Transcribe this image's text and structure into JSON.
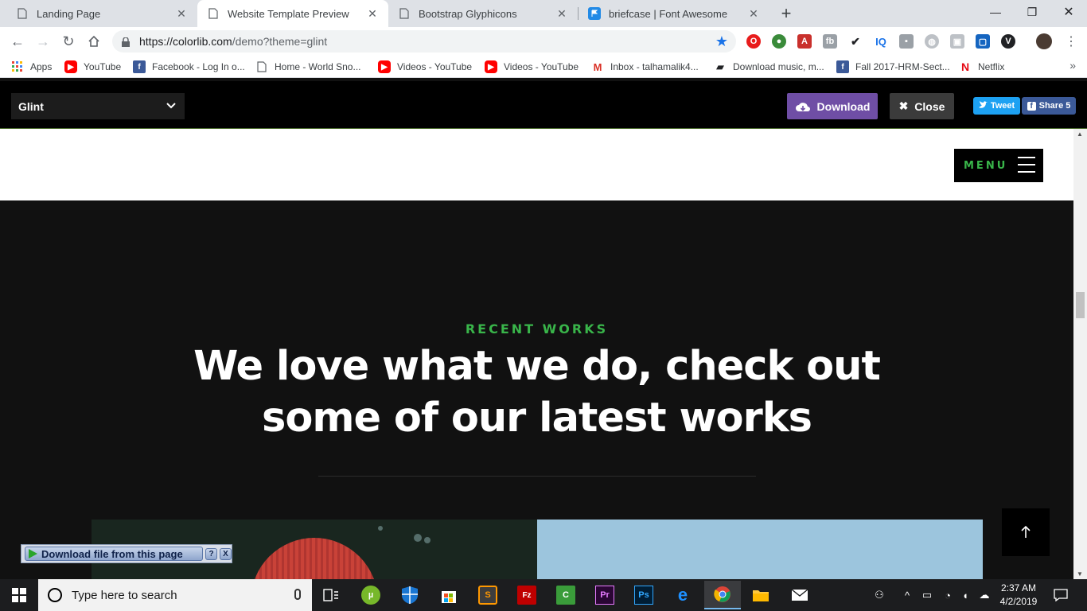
{
  "browser": {
    "tabs": [
      {
        "title": "Landing Page"
      },
      {
        "title": "Website Template Preview"
      },
      {
        "title": "Bootstrap Glyphicons"
      },
      {
        "title": "briefcase | Font Awesome"
      }
    ],
    "url_main": "https://colorlib.com",
    "url_rest": "/demo?theme=glint",
    "bookmarks": [
      {
        "label": "Apps",
        "icon": "apps-grid-icon",
        "color": "#e8453c"
      },
      {
        "label": "YouTube",
        "icon": "youtube-icon",
        "color": "#ff0000"
      },
      {
        "label": "Facebook - Log In o...",
        "icon": "facebook-icon",
        "color": "#3b5998"
      },
      {
        "label": "Home - World Sno...",
        "icon": "page-icon",
        "color": "#5f6368"
      },
      {
        "label": "Videos - YouTube",
        "icon": "youtube-icon",
        "color": "#ff0000"
      },
      {
        "label": "Videos - YouTube",
        "icon": "youtube-icon",
        "color": "#ff0000"
      },
      {
        "label": "Inbox - talhamalik4...",
        "icon": "gmail-icon",
        "color": "#d93025"
      },
      {
        "label": "Download music, m...",
        "icon": "download-music-icon",
        "color": "#202124"
      },
      {
        "label": "Fall 2017-HRM-Sect...",
        "icon": "facebook-icon",
        "color": "#3b5998"
      },
      {
        "label": "Netflix",
        "icon": "netflix-icon",
        "color": "#e50914"
      }
    ]
  },
  "preview_bar": {
    "theme_name": "Glint",
    "download_label": "Download",
    "close_label": "Close",
    "tweet_label": "Tweet",
    "share_label": "Share 5",
    "download_color": "#6f4ea5",
    "accent": "#39b54a"
  },
  "site": {
    "menu_label": "MENU",
    "kicker": "RECENT WORKS",
    "headline": "We love what we do, check out some of our latest works"
  },
  "download_helper": {
    "label": "Download file from this page",
    "help": "?",
    "close": "X"
  },
  "taskbar": {
    "search_placeholder": "Type here to search",
    "time": "2:37 AM",
    "date": "4/2/2019"
  }
}
